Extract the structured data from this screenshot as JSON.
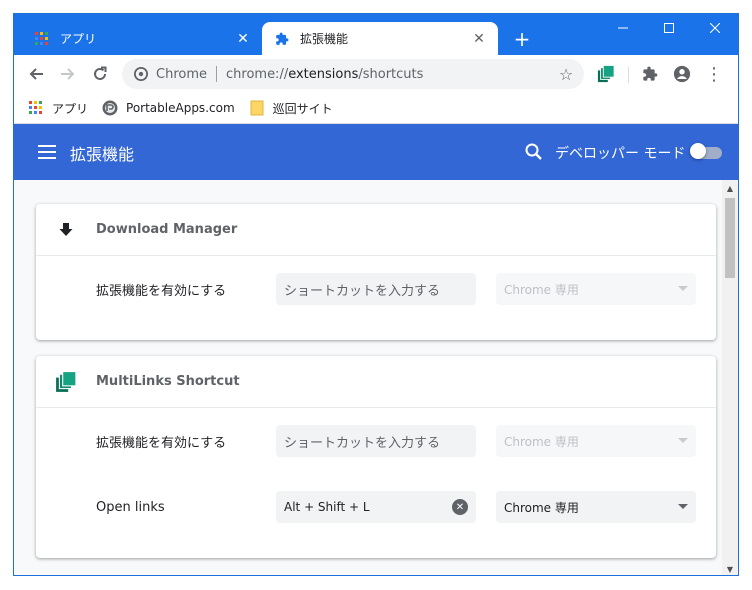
{
  "tabs": [
    {
      "title": "アプリ",
      "icon": "apps-grid-icon",
      "active": false
    },
    {
      "title": "拡張機能",
      "icon": "puzzle-piece-icon",
      "active": true
    }
  ],
  "new_tab_label": "+",
  "window_controls": {
    "minimize": "—",
    "maximize": "☐",
    "close": "✕"
  },
  "toolbar": {
    "back": "←",
    "forward": "→",
    "reload": "↻",
    "omnibox": {
      "site_label": "Chrome",
      "url_scheme": "chrome://",
      "url_host": "extensions",
      "url_path": "/shortcuts"
    },
    "star": "☆",
    "menu": "⋮"
  },
  "bookmarks": [
    {
      "label": "アプリ",
      "icon": "apps-grid-icon"
    },
    {
      "label": "PortableApps.com",
      "icon": "portableapps-icon"
    },
    {
      "label": "巡回サイト",
      "icon": "folder-icon"
    }
  ],
  "header": {
    "title": "拡張機能",
    "developer_mode_label": "デベロッパー モード",
    "developer_mode_on": false
  },
  "extensions": [
    {
      "name": "Download Manager",
      "icon": "download-arrow-icon",
      "commands": [
        {
          "label": "拡張機能を有効にする",
          "shortcut": "",
          "placeholder": "ショートカットを入力する",
          "scope": "Chrome 専用",
          "scope_enabled": false
        }
      ]
    },
    {
      "name": "MultiLinks Shortcut",
      "icon": "stacked-pages-icon",
      "commands": [
        {
          "label": "拡張機能を有効にする",
          "shortcut": "",
          "placeholder": "ショートカットを入力する",
          "scope": "Chrome 専用",
          "scope_enabled": false
        },
        {
          "label": "Open links",
          "shortcut": "Alt + Shift + L",
          "placeholder": "",
          "scope": "Chrome 専用",
          "scope_enabled": true
        }
      ]
    }
  ],
  "colors": {
    "tabstrip": "#1a73e8",
    "header": "#3367d6",
    "extension_green": "#0f8a6d"
  }
}
